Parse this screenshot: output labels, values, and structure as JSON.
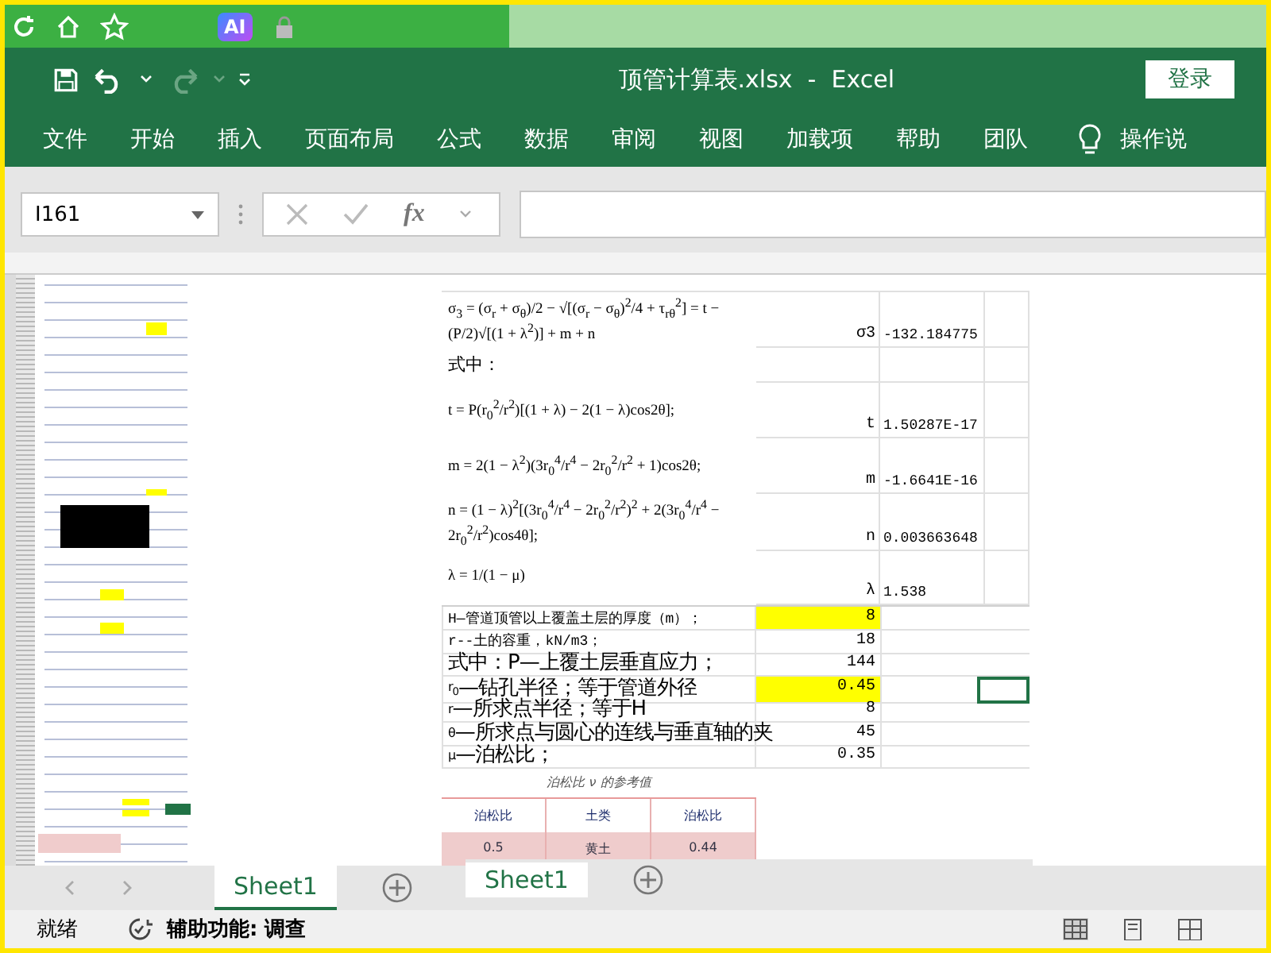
{
  "browser_bar": {
    "ai_badge": "AI"
  },
  "title_bar": {
    "title": "顶管计算表.xlsx  -  Excel",
    "login": "登录"
  },
  "ribbon_tabs": [
    {
      "label": "文件"
    },
    {
      "label": "开始"
    },
    {
      "label": "插入"
    },
    {
      "label": "页面布局"
    },
    {
      "label": "公式"
    },
    {
      "label": "数据"
    },
    {
      "label": "审阅"
    },
    {
      "label": "视图"
    },
    {
      "label": "加载项"
    },
    {
      "label": "帮助"
    },
    {
      "label": "团队"
    }
  ],
  "tell_me": "操作说",
  "formula_bar": {
    "name_box": "I161",
    "fx": "fx"
  },
  "formula_rows": [
    {
      "formula": "σ$_{3}$ = (σ$_{r}$ + σ$_{θ}$)/2 − √[(σ$_{r}$ − σ$_{θ}$)$^{2}$/4 + τ$_{rθ}$$^{2}$] = t − (P/2)√[(1 + λ$^{2}$)] + m + n",
      "label": "σ3",
      "value": "-132.184775"
    },
    {
      "formula": "式中："
    },
    {
      "formula": "t = P(r$_{0}$$^{2}$/r$^{2}$)[(1 + λ) − 2(1 − λ)cos2θ];",
      "label": "t",
      "value": "1.50287E-17"
    },
    {
      "formula": "m = 2(1 − λ$^{2}$)(3r$_{0}$$^{4}$/r$^{4}$ − 2r$_{0}$$^{2}$/r$^{2}$ + 1)cos2θ;",
      "label": "m",
      "value": "-1.6641E-16"
    },
    {
      "formula": "n = (1 − λ)$^{2}$[(3r$_{0}$$^{4}$/r$^{4}$ − 2r$_{0}$$^{2}$/r$^{2}$)$^{2}$ + 2(3r$_{0}$$^{4}$/r$^{4}$ − 2r$_{0}$$^{2}$/r$^{2}$)cos4θ];",
      "label": "n",
      "value": "0.003663648"
    },
    {
      "formula": "λ = 1/(1 − μ)",
      "label": "λ",
      "value": "1.538"
    }
  ],
  "param_rows": [
    {
      "kind": "small",
      "text": "H—管道顶管以上覆盖土层的厚度（m）；",
      "value": "8",
      "highlighted": true,
      "selected": false
    },
    {
      "kind": "small",
      "text": "r--土的容重，kN/m3；",
      "value": "18",
      "highlighted": false,
      "selected": false
    },
    {
      "kind": "large",
      "text": "式中：P—上覆土层垂直应力；",
      "value": "144",
      "highlighted": false,
      "selected": false
    },
    {
      "kind": "large",
      "symbol": "r$_{0}$",
      "text": "—钻孔半径；等于管道外径",
      "value": "0.45",
      "highlighted": true,
      "selected": true
    },
    {
      "kind": "large",
      "symbol": "r",
      "text": "—所求点半径；等于H",
      "value": "8",
      "highlighted": false,
      "selected": false
    },
    {
      "kind": "large",
      "symbol": "θ",
      "text": "—所求点与圆心的连线与垂直轴的夹",
      "value": "45",
      "highlighted": false,
      "selected": false
    },
    {
      "kind": "large",
      "symbol": "μ",
      "text": "—泊松比；",
      "value": "0.35",
      "highlighted": false,
      "selected": false
    }
  ],
  "reference_table": {
    "caption": "泊松比 ν 的参考值",
    "columns": [
      "泊松比",
      "土类",
      "泊松比"
    ],
    "rows": [
      [
        "0.5",
        "黄土",
        "0.44"
      ]
    ]
  },
  "sheet_tabs": [
    {
      "label": "Sheet1",
      "selected": true
    }
  ],
  "overlay_sheet_tabs": [
    {
      "label": "Sheet1",
      "selected": true
    }
  ],
  "status_bar": {
    "state": "就绪",
    "accessibility": "辅助功能: 调查"
  }
}
